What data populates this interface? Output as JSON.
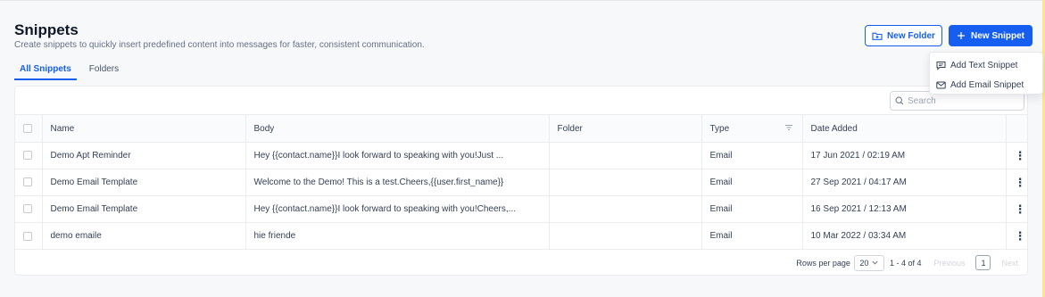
{
  "page": {
    "title": "Snippets",
    "subtitle": "Create snippets to quickly insert predefined content into messages for faster, consistent communication."
  },
  "tabs": [
    {
      "label": "All Snippets",
      "active": true
    },
    {
      "label": "Folders",
      "active": false
    }
  ],
  "actions": {
    "new_folder": "New Folder",
    "new_snippet": "New Snippet",
    "dropdown": [
      "Add Text Snippet",
      "Add Email Snippet"
    ]
  },
  "search": {
    "placeholder": "Search"
  },
  "table": {
    "columns": [
      "Name",
      "Body",
      "Folder",
      "Type",
      "Date Added"
    ],
    "rows": [
      {
        "name": "Demo Apt Reminder",
        "body": "Hey {{contact.name}}I look forward to speaking with you!Just ...",
        "folder": "",
        "type": "Email",
        "date": "17 Jun 2021 / 02:19 AM"
      },
      {
        "name": "Demo Email Template",
        "body": "Welcome to the Demo! This is a test.Cheers,{{user.first_name}}",
        "folder": "",
        "type": "Email",
        "date": "27 Sep 2021 / 04:17 AM"
      },
      {
        "name": "Demo Email Template",
        "body": "Hey {{contact.name}}I look forward to speaking with you!Cheers,...",
        "folder": "",
        "type": "Email",
        "date": "16 Sep 2021 / 12:13 AM"
      },
      {
        "name": "demo emaile",
        "body": "hie friende",
        "folder": "",
        "type": "Email",
        "date": "10 Mar 2022 / 03:34 AM"
      }
    ]
  },
  "pagination": {
    "rows_per_page_label": "Rows per page",
    "rows_per_page": "20",
    "range": "1 - 4 of 4",
    "previous": "Previous",
    "next": "Next",
    "current_page": "1"
  },
  "colors": {
    "accent": "#155eef",
    "background": "#f7f8fa"
  },
  "icons": [
    "folder-plus-icon",
    "plus-icon",
    "message-square-icon",
    "mail-icon",
    "search-icon",
    "filter-icon",
    "kebab-icon",
    "chevron-down-icon"
  ]
}
